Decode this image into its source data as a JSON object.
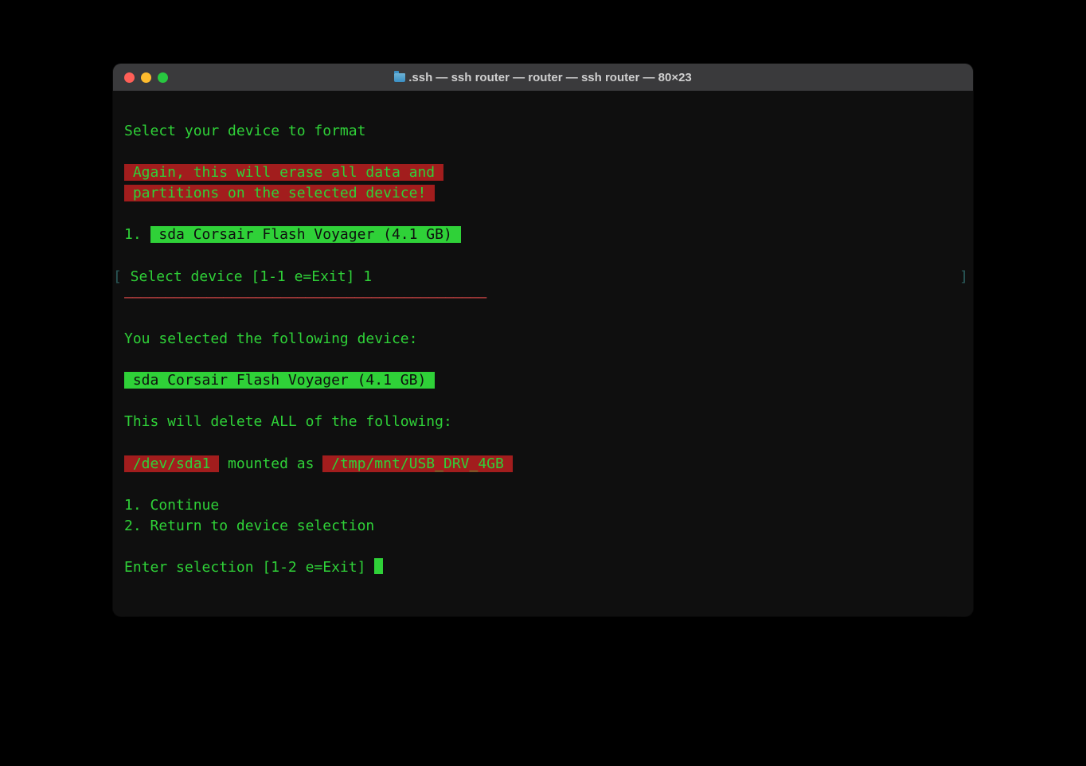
{
  "window": {
    "title": ".ssh — ssh router — router — ssh router — 80×23"
  },
  "terminal": {
    "header": "Select your device to format",
    "warning_line1": " Again, this will erase all data and ",
    "warning_line2": " partitions on the selected device! ",
    "device_list_num": "1. ",
    "device_list_item": " sda Corsair Flash Voyager (4.1 GB) ",
    "prompt1_bracket_left": "[",
    "prompt1_text": " Select device [1-1 e=Exit] 1",
    "prompt1_bracket_right": "]",
    "divider": "————————————————————————————————————————————",
    "selected_heading": "You selected the following device:",
    "selected_device": " sda Corsair Flash Voyager (4.1 GB) ",
    "delete_heading": "This will delete ALL of the following:",
    "delete_dev": " /dev/sda1 ",
    "delete_mounted_as": " mounted as ",
    "delete_mount": " /tmp/mnt/USB_DRV_4GB ",
    "option1": "1. Continue",
    "option2": "2. Return to device selection",
    "prompt2": "Enter selection [1-2 e=Exit] "
  },
  "colors": {
    "terminal_bg": "#0f0f0f",
    "green": "#2fd138",
    "red_bg": "#a21d1d"
  }
}
